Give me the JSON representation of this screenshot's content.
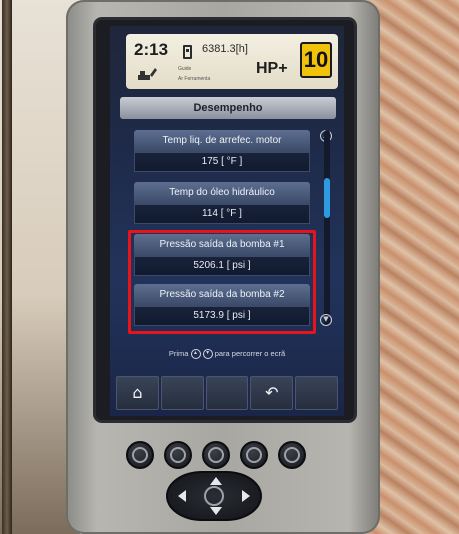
{
  "status_bar": {
    "time": "2:13",
    "engine_hours": "6381.3[h]",
    "power_mode": "HP+",
    "level_value": "10",
    "small_text_1": "Guide",
    "small_text_2": "Ar Ferramenta"
  },
  "screen": {
    "title": "Desempenho"
  },
  "params": [
    {
      "label": "Temp liq. de arrefec. motor",
      "value": "175 [ °F ]"
    },
    {
      "label": "Temp do óleo hidráulico",
      "value": "114 [ °F ]"
    },
    {
      "label": "Pressão saída da bomba #1",
      "value": "5206.1 [ psi ]"
    },
    {
      "label": "Pressão saída da bomba #2",
      "value": "5173.9 [ psi ]"
    }
  ],
  "hint": {
    "prefix": "Prima",
    "suffix": "para percorrer o ecrã"
  },
  "softkeys": [
    {
      "icon": "home-icon",
      "glyph": "⌂"
    },
    {
      "icon": "blank",
      "glyph": ""
    },
    {
      "icon": "blank",
      "glyph": ""
    },
    {
      "icon": "return-icon",
      "glyph": "↶"
    },
    {
      "icon": "blank",
      "glyph": ""
    }
  ],
  "colors": {
    "highlight": "#e8141b",
    "badge": "#f0c20a",
    "scroll_thumb": "#2f9ae0"
  }
}
